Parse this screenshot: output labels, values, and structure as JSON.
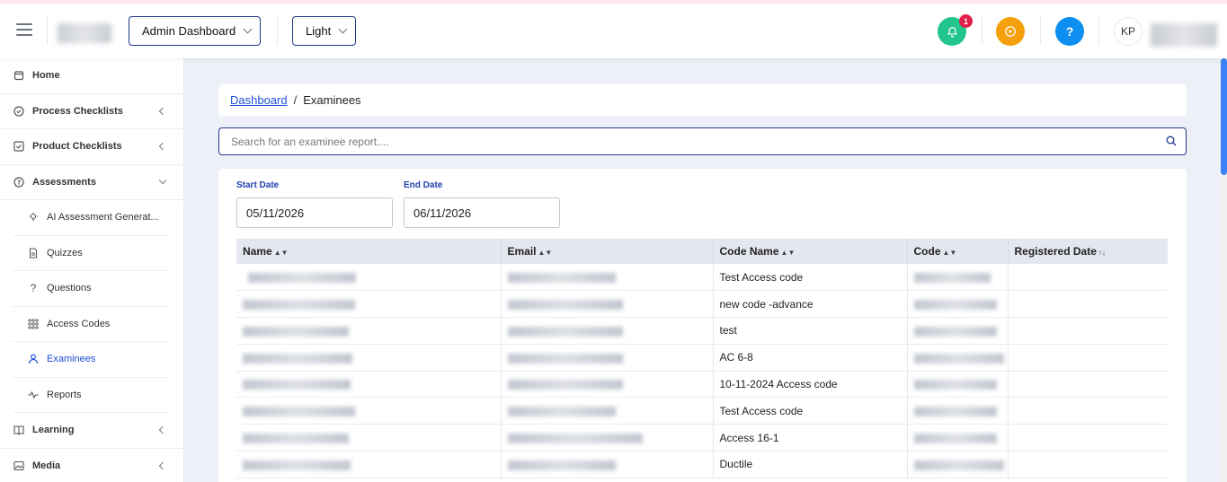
{
  "topbar": {
    "dashboard_select": "Admin Dashboard",
    "theme_select": "Light",
    "notification_count": "1",
    "help_label": "?",
    "avatar_initials": "KP",
    "colors": {
      "notify": "#22c58b",
      "play": "#f5a00a",
      "help": "#0d8ef0"
    }
  },
  "sidebar": {
    "home": "Home",
    "process_checklists": "Process Checklists",
    "product_checklists": "Product Checklists",
    "assessments": "Assessments",
    "ai_generator": "AI Assessment Generat...",
    "quizzes": "Quizzes",
    "questions": "Questions",
    "access_codes": "Access Codes",
    "examinees": "Examinees",
    "reports": "Reports",
    "learning": "Learning",
    "media": "Media"
  },
  "breadcrumb": {
    "root": "Dashboard",
    "separator": "/",
    "current": "Examinees"
  },
  "search": {
    "placeholder": "Search for an examinee report...."
  },
  "filters": {
    "start_label": "Start Date",
    "start_value": "05/11/2026",
    "end_label": "End Date",
    "end_value": "06/11/2026"
  },
  "table": {
    "columns": [
      "Name",
      "Email",
      "Code Name",
      "Code",
      "Registered Date"
    ],
    "rows": [
      {
        "code_name": "Test Access code"
      },
      {
        "code_name": "new code -advance"
      },
      {
        "code_name": "test"
      },
      {
        "code_name": "AC 6-8"
      },
      {
        "code_name": "10-11-2024 Access code"
      },
      {
        "code_name": "Test Access code"
      },
      {
        "code_name": "Access 16-1"
      },
      {
        "code_name": "Ductile"
      }
    ]
  }
}
